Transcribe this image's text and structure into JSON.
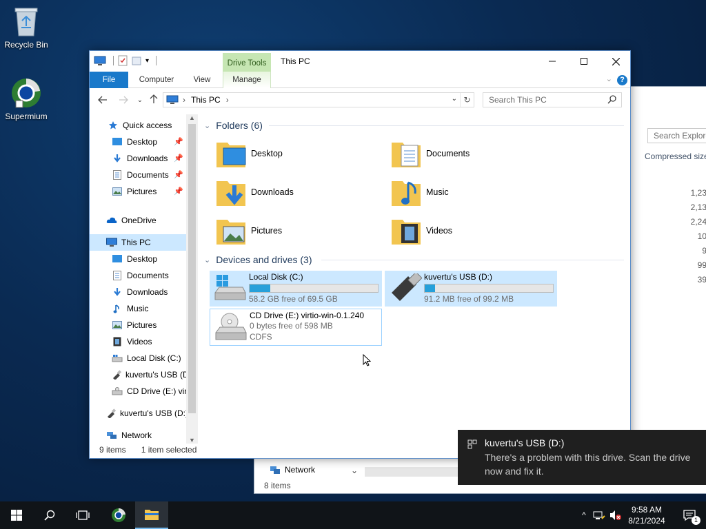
{
  "desktop": {
    "icons": [
      {
        "label": "Recycle Bin",
        "icon": "recycle-bin-icon"
      },
      {
        "label": "Supermium",
        "icon": "supermium-browser-icon"
      }
    ]
  },
  "background_window": {
    "search_placeholder": "Search Explore",
    "column_header": "Compressed size",
    "sizes": [
      "1,23",
      "2,13",
      "2,24",
      "10",
      "9",
      "99",
      "39"
    ],
    "nav_network": "Network",
    "status": "8 items"
  },
  "window": {
    "title": "This PC",
    "context_tab": "Drive Tools",
    "ribbon_tabs": [
      "File",
      "Computer",
      "View",
      "Manage"
    ],
    "address_crumb": "This PC",
    "search_placeholder": "Search This PC",
    "status_items": "9 items",
    "status_selected": "1 item selected"
  },
  "nav": {
    "quick_access": "Quick access",
    "quick_items": [
      "Desktop",
      "Downloads",
      "Documents",
      "Pictures"
    ],
    "onedrive": "OneDrive",
    "this_pc": "This PC",
    "pc_items": [
      "Desktop",
      "Documents",
      "Downloads",
      "Music",
      "Pictures",
      "Videos",
      "Local Disk (C:)",
      "kuvertu's USB (D",
      "CD Drive (E:) virt"
    ],
    "usb_root": "kuvertu's USB (D:)",
    "network": "Network"
  },
  "content": {
    "folders_header": "Folders (6)",
    "folders": [
      "Desktop",
      "Documents",
      "Downloads",
      "Music",
      "Pictures",
      "Videos"
    ],
    "drives_header": "Devices and drives (3)",
    "drives": [
      {
        "name": "Local Disk (C:)",
        "free": "58.2 GB free of 69.5 GB",
        "used_fraction": 0.163
      },
      {
        "name": "kuvertu's USB (D:)",
        "free": "91.2 MB free of 99.2 MB",
        "used_fraction": 0.081
      },
      {
        "name": "CD Drive (E:) virtio-win-0.1.240",
        "free": "0 bytes free of 598 MB",
        "fs": "CDFS"
      }
    ]
  },
  "toast": {
    "title": "kuvertu's USB (D:)",
    "body": "There's a problem with this drive.  Scan the drive now and fix it."
  },
  "taskbar": {
    "time": "9:58 AM",
    "date": "8/21/2024",
    "notification_count": "1"
  }
}
